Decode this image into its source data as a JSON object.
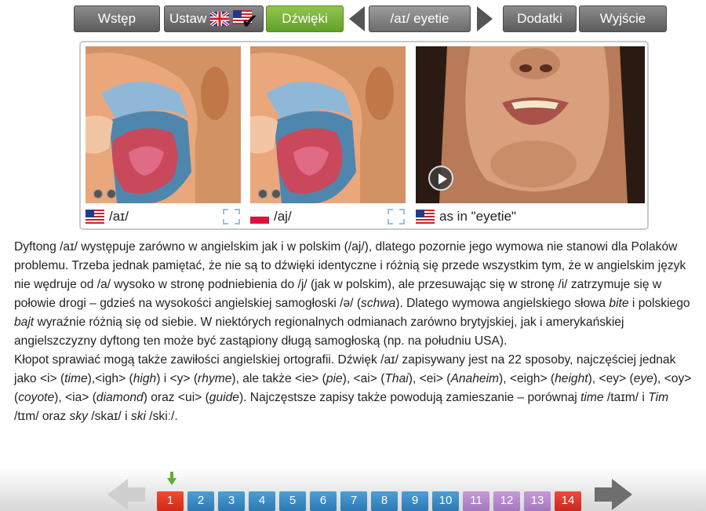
{
  "nav": {
    "intro": "Wstęp",
    "settings": "Ustaw",
    "sounds": "Dźwięki",
    "current_sound": "/aɪ/ eyetie",
    "extras": "Dodatki",
    "exit": "Wyjście"
  },
  "media": {
    "caption1": "/aɪ/",
    "caption2": "/aj/",
    "caption3": "as in \"eyetie\""
  },
  "text": {
    "p1_a": "Dyftong /aɪ/ występuje zarówno w angielskim jak i w polskim (/aj/), dlatego pozornie jego wymowa nie stanowi dla Polaków problemu. Trzeba jednak pamiętać, że nie są to dźwięki identyczne i różnią się przede wszystkim tym, że w angielskim język nie wędruje od /a/ wysoko w stronę podniebienia do /j/ (jak w polskim), ale przesuwając się w stronę /i/ zatrzymuje się w połowie drogi – gdzieś na wysokości angielskiej samogłoski /ə/ (",
    "p1_schwa": "schwa",
    "p1_b": "). Dlatego wymowa angielskiego słowa ",
    "p1_bite": "bite",
    "p1_c": " i polskiego ",
    "p1_bajt": "bajt",
    "p1_d": " wyraźnie różnią się od siebie. W niektórych regionalnych odmianach zarówno brytyjskiej, jak i amerykańskiej angielszczyzny dyftong ten może być zastąpiony długą samogłoską (np. na południu USA).",
    "p2_a": "Kłopot sprawiać mogą także zawiłości angielskiej ortografii. Dźwięk /aɪ/ zapisywany jest na 22 sposoby, najczęściej jednak jako <i> (",
    "w_time": "time",
    "p2_b": "),<igh> (",
    "w_high": "high",
    "p2_c": ") i <y> (",
    "w_rhyme": "rhyme",
    "p2_d": "), ale także <ie> (",
    "w_pie": "pie",
    "p2_e": "), <ai> (",
    "w_thai": "Thai",
    "p2_f": "), <ei> (",
    "w_anaheim": "Anaheim",
    "p2_g": "), <eigh> (",
    "w_height": "height",
    "p2_h": "), <ey> (",
    "w_eye": "eye",
    "p2_i": "), <oy> (",
    "w_coyote": "coyote",
    "p2_j": "), <ia> (",
    "w_diamond": "diamond",
    "p2_k": ") oraz <ui> (",
    "w_guide": "guide",
    "p2_l": "). Najczęstsze zapisy także powodują zamieszanie – porównaj ",
    "w_time2": "time",
    "p2_m": " /taɪm/ i ",
    "w_tim": "Tim",
    "p2_n": " /tɪm/ oraz ",
    "w_sky": "sky",
    "p2_o": " /skaɪ/ i ",
    "w_ski": "ski",
    "p2_p": " /skiː/."
  },
  "pager": {
    "pages": [
      {
        "label": "1",
        "style": "current"
      },
      {
        "label": "2",
        "style": "blue"
      },
      {
        "label": "3",
        "style": "blue"
      },
      {
        "label": "4",
        "style": "blue"
      },
      {
        "label": "5",
        "style": "blue"
      },
      {
        "label": "6",
        "style": "blue"
      },
      {
        "label": "7",
        "style": "blue"
      },
      {
        "label": "8",
        "style": "blue"
      },
      {
        "label": "9",
        "style": "blue"
      },
      {
        "label": "10",
        "style": "blue"
      },
      {
        "label": "11",
        "style": "purple"
      },
      {
        "label": "12",
        "style": "purple"
      },
      {
        "label": "13",
        "style": "purple"
      },
      {
        "label": "14",
        "style": "red"
      }
    ]
  },
  "colors": {
    "active_tab": "#6fae34",
    "page_blue": "#3a89c6",
    "page_purple": "#b487c9",
    "page_red": "#e0392b"
  }
}
